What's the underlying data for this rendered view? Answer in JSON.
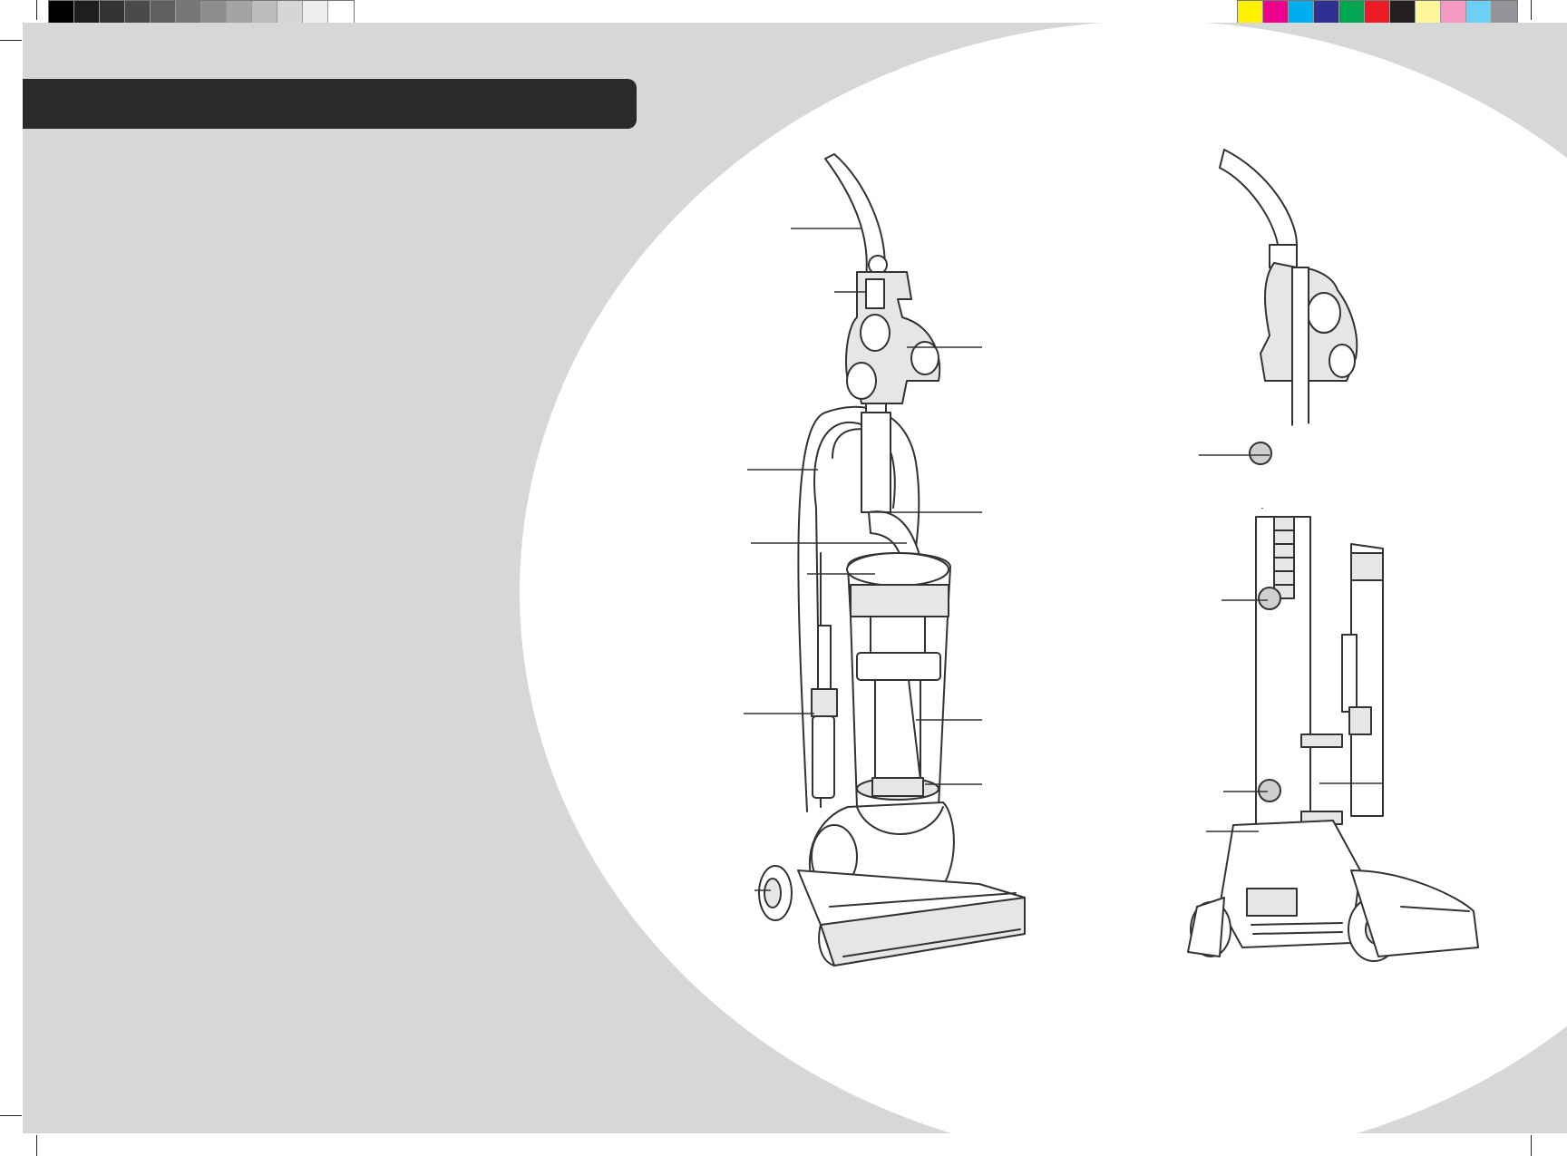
{
  "color_bar_left": [
    "#000000",
    "#1e1e1e",
    "#333333",
    "#4a4a4a",
    "#5f5f5f",
    "#777777",
    "#8d8d8d",
    "#a4a4a4",
    "#bcbcbc",
    "#d6d6d6",
    "#eeeeee",
    "#ffffff"
  ],
  "color_bar_right": [
    "#fff200",
    "#ec008c",
    "#00aeef",
    "#2e3192",
    "#00a651",
    "#ed1c24",
    "#231f20",
    "#fff799",
    "#f49ac2",
    "#6dcff6",
    "#939598"
  ],
  "colors": {
    "page_background": "#d6d7d7",
    "header_bar": "#2a2a2a",
    "circle": "#ffffff",
    "line_art": "#333333"
  },
  "illustrations": [
    {
      "view": "front",
      "callout_count": 11
    },
    {
      "view": "side",
      "callout_count": 5
    }
  ]
}
